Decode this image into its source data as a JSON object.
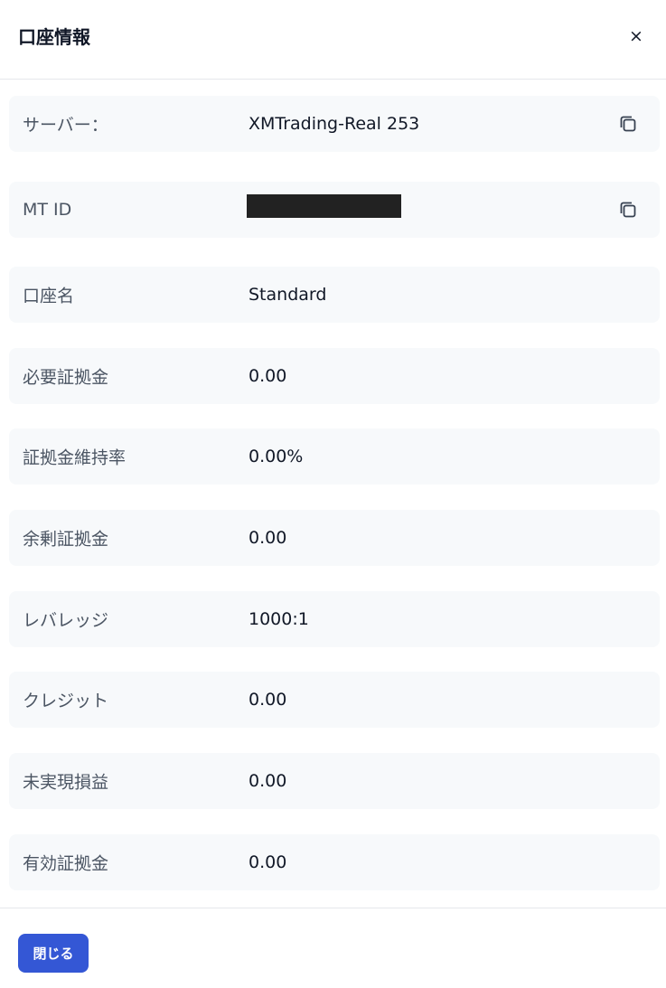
{
  "dialog": {
    "title": "口座情報",
    "close_icon": "close-icon",
    "close_symbol": "×"
  },
  "rows": [
    {
      "label": "サーバー：",
      "value": "XMTrading-Real 253",
      "copyable": true
    },
    {
      "label": "MT ID",
      "value": "",
      "redacted": true,
      "copyable": true
    },
    {
      "label": "口座名",
      "value": "Standard"
    },
    {
      "label": "必要証拠金",
      "value": "0.00"
    },
    {
      "label": "証拠金維持率",
      "value": "0.00%"
    },
    {
      "label": "余剰証拠金",
      "value": "0.00"
    },
    {
      "label": "レバレッジ",
      "value": "1000:1"
    },
    {
      "label": "クレジット",
      "value": "0.00"
    },
    {
      "label": "未実現損益",
      "value": "0.00"
    },
    {
      "label": "有効証拠金",
      "value": "0.00"
    }
  ],
  "footer": {
    "close_button_label": "閉じる"
  },
  "colors": {
    "primary_button": "#3457d5",
    "row_background": "#f7f9fb",
    "label_text": "#4b5563",
    "value_text": "#111827"
  }
}
